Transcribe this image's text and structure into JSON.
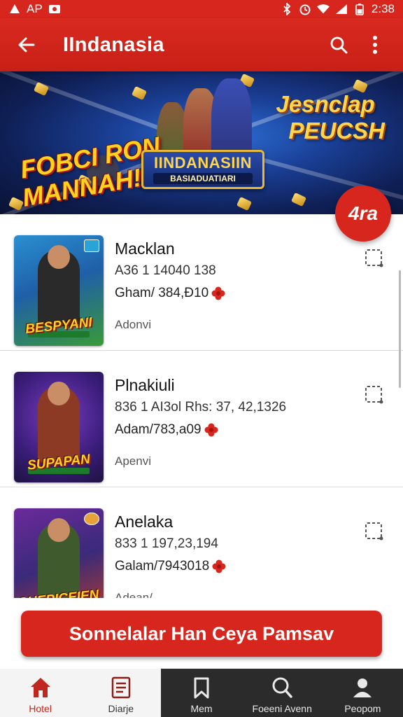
{
  "status_bar": {
    "left_text": "AP",
    "time": "2:38"
  },
  "app_bar": {
    "title": "IIndanasia",
    "back_icon": "arrow-back-icon",
    "search_icon": "search-icon",
    "menu_icon": "more-vert-icon"
  },
  "banner": {
    "left_line1": "FOBCI RON",
    "left_line2": "MANNAH!",
    "right_line1": "Jesnclap",
    "right_line2": "PEUCSH",
    "logo_title": "IINDANASIIN",
    "logo_subtitle": "BASIADUATIARI"
  },
  "fab": {
    "label": "4ra"
  },
  "items": [
    {
      "name": "Macklan",
      "line1": "A36 1 14040 138",
      "line2": "Gham/ 384,Ð10",
      "line3": "Adonvi",
      "thumb_caption": "BESPYANI",
      "colors": {
        "bg1": "#2a8fd0",
        "bg2": "#3a9a38",
        "figure": "#2a2a2a"
      }
    },
    {
      "name": "Plnakiuli",
      "line1": "836 1 AI3ol Rhs:  37, 42,1326",
      "line2": "Adam/783,a09",
      "line3": "Apenvi",
      "thumb_caption": "SUPAPAN",
      "colors": {
        "bg1": "#5a2c8f",
        "bg2": "#2a1b5e",
        "figure": "#8c3a24"
      }
    },
    {
      "name": "Anelaka",
      "line1": "833 1 197,23,194",
      "line2": "Galam/7943018",
      "line3": "Adean/",
      "thumb_caption": "SHEPICEIEN",
      "colors": {
        "bg1": "#6b2a9a",
        "bg2": "#b43b2a",
        "figure": "#3f5a2c"
      }
    }
  ],
  "cta": {
    "label": "Sonnelalar Han Ceya Pamsav"
  },
  "bottom_nav": [
    {
      "label": "Hotel",
      "icon": "home-icon"
    },
    {
      "label": "Diarje",
      "icon": "document-icon"
    },
    {
      "label": "Mem",
      "icon": "bookmark-icon"
    },
    {
      "label": "Foeeni Avenn",
      "icon": "search-icon"
    },
    {
      "label": "Peopom",
      "icon": "person-icon"
    }
  ],
  "colors": {
    "primary": "#d7261d",
    "nav_dark": "#2b2b2b"
  }
}
